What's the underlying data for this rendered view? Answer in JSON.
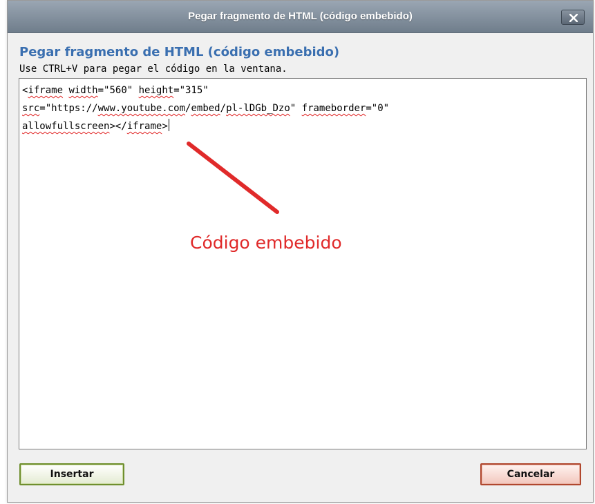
{
  "dialog": {
    "title": "Pegar fragmento de HTML (código embebido)",
    "heading": "Pegar fragmento de HTML (código embebido)",
    "instruction": "Use CTRL+V para pegar el código en la ventana."
  },
  "code": {
    "line1": [
      {
        "text": "<"
      },
      {
        "text": "iframe",
        "sq": true
      },
      {
        "text": " "
      },
      {
        "text": "width",
        "sq": true
      },
      {
        "text": "=\"560\" "
      },
      {
        "text": "height",
        "sq": true
      },
      {
        "text": "=\"315\""
      }
    ],
    "line2": [
      {
        "text": "src",
        "sq": true
      },
      {
        "text": "=\"https://"
      },
      {
        "text": "www.youtube.com",
        "sq": true
      },
      {
        "text": "/"
      },
      {
        "text": "embed",
        "sq": true
      },
      {
        "text": "/"
      },
      {
        "text": "pl-lDGb_Dzo",
        "sq": true
      },
      {
        "text": "\" "
      },
      {
        "text": "frameborder",
        "sq": true
      },
      {
        "text": "=\"0\""
      }
    ],
    "line3": [
      {
        "text": "allowfullscreen",
        "sq": true
      },
      {
        "text": "></"
      },
      {
        "text": "iframe",
        "sq": true
      },
      {
        "text": ">"
      }
    ]
  },
  "annotation": {
    "label": "Código embebido",
    "color": "#e02a2a"
  },
  "buttons": {
    "insert_label": "Insertar",
    "cancel_label": "Cancelar"
  },
  "icons": {
    "close": "close-icon"
  }
}
